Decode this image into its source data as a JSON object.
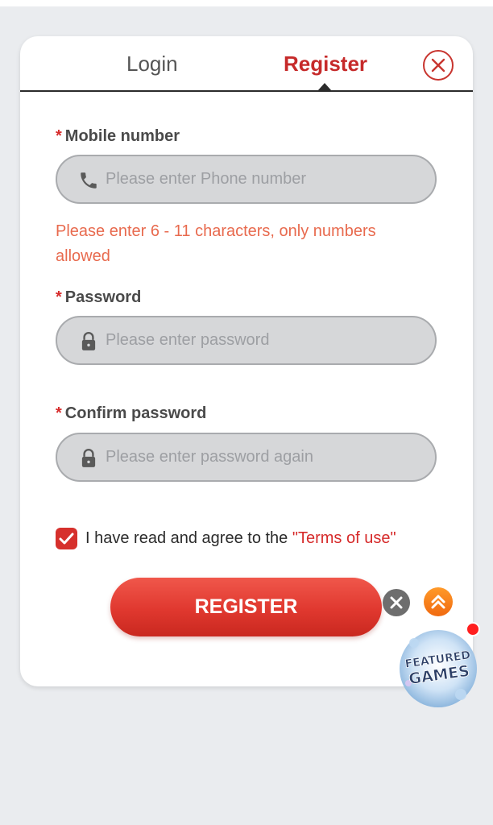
{
  "tabs": {
    "login": "Login",
    "register": "Register"
  },
  "form": {
    "mobile": {
      "label": "Mobile number",
      "placeholder": "Please enter Phone number",
      "value": ""
    },
    "mobile_error": "Please enter 6 - 11 characters, only numbers allowed",
    "password": {
      "label": "Password",
      "placeholder": "Please enter password",
      "value": ""
    },
    "confirm": {
      "label": "Confirm password",
      "placeholder": "Please enter password again",
      "value": ""
    },
    "required_marker": "*",
    "agree_text": "I have read and agree to the ",
    "terms_link": "\"Terms of use\"",
    "agree_checked": true,
    "submit_label": "REGISTER"
  },
  "floating": {
    "featured_line1": "FEATURED",
    "featured_line2": "GAMES"
  },
  "colors": {
    "accent": "#d62a2a",
    "error": "#e86a4e",
    "field_bg": "#d6d7d9",
    "page_bg": "#eaecef"
  },
  "icons": [
    "close-icon",
    "phone-icon",
    "lock-icon",
    "checkmark-icon",
    "chevron-up-icon"
  ]
}
